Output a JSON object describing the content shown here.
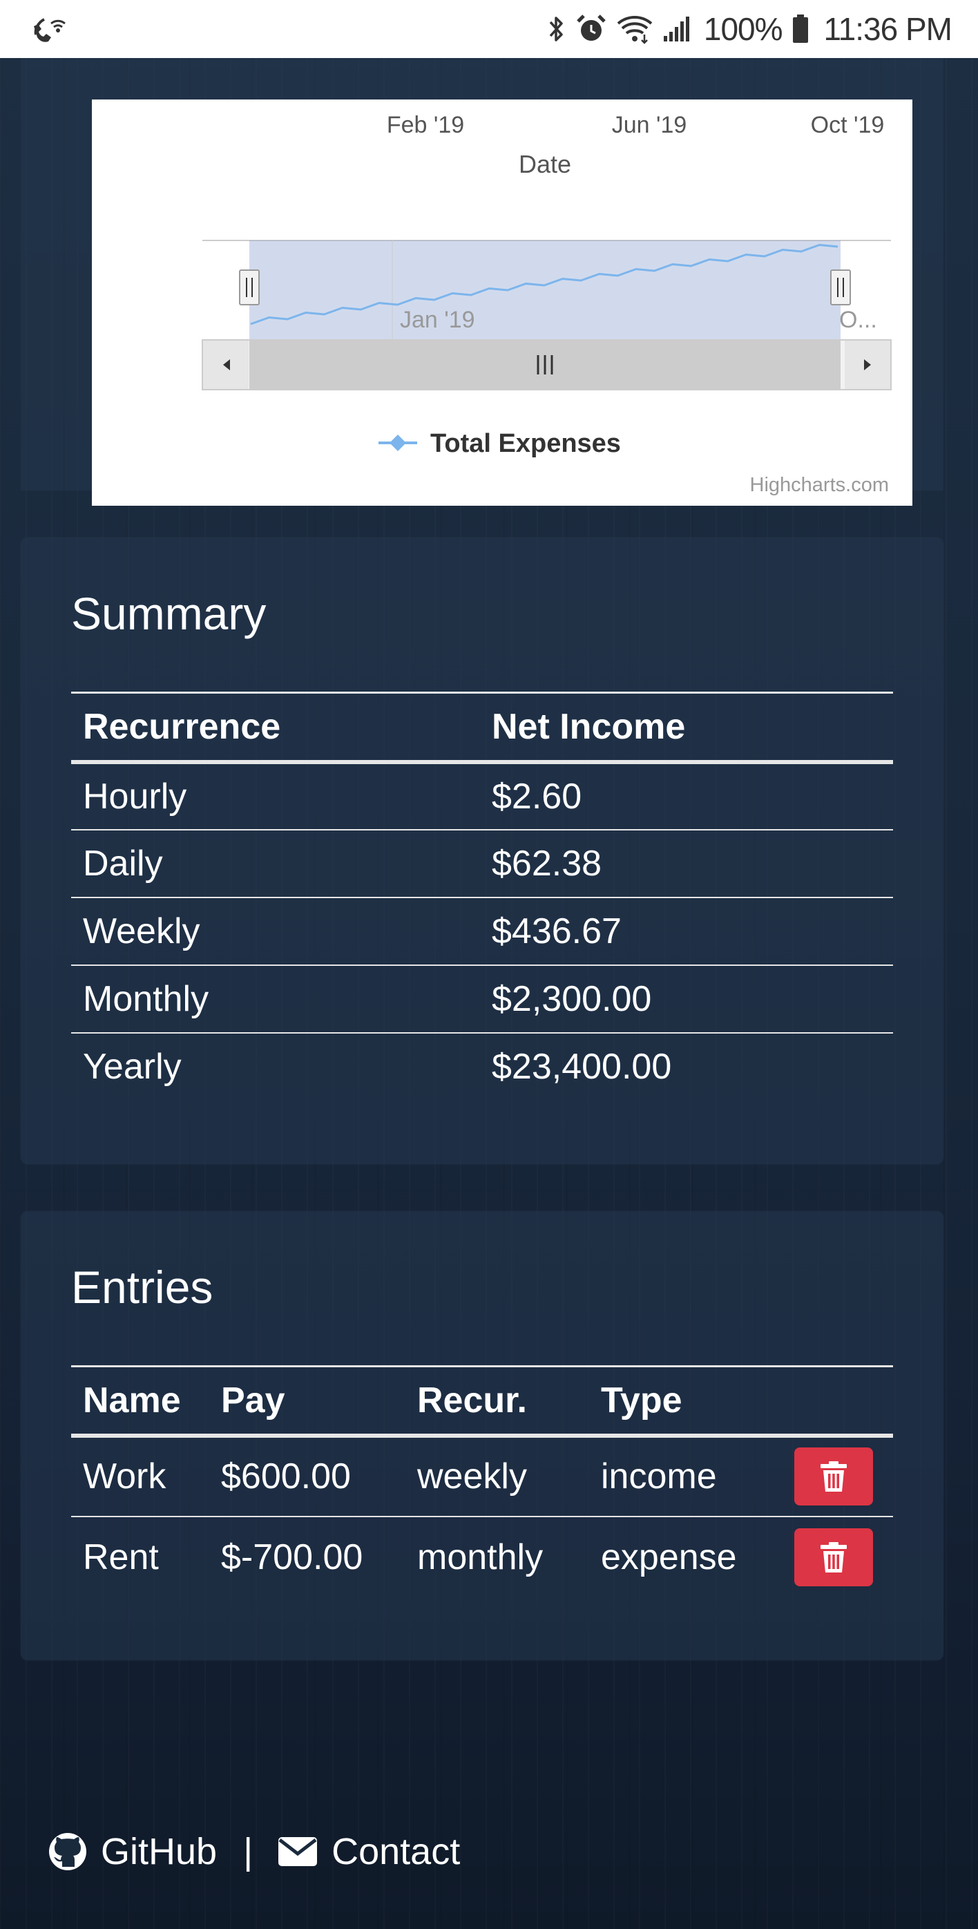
{
  "status_bar": {
    "battery": "100%",
    "time": "11:36 PM",
    "icons": [
      "wifi-calling-icon",
      "bluetooth-icon",
      "alarm-icon",
      "wifi-icon",
      "signal-icon",
      "battery-icon"
    ]
  },
  "chart_data": {
    "type": "line",
    "title": "",
    "xlabel": "Date",
    "ylabel": "",
    "x_ticks": [
      "Feb '19",
      "Jun '19",
      "Oct '19"
    ],
    "navigator": {
      "tick_labels": [
        "Jan '19",
        "O..."
      ],
      "series_trend": "increasing"
    },
    "series": [
      {
        "name": "Total Expenses",
        "color": "#7cb5ec"
      }
    ],
    "legend_placement": "bottom-center",
    "credit": "Highcharts.com"
  },
  "summary": {
    "title": "Summary",
    "columns": [
      "Recurrence",
      "Net Income"
    ],
    "rows": [
      {
        "recurrence": "Hourly",
        "net_income": "$2.60"
      },
      {
        "recurrence": "Daily",
        "net_income": "$62.38"
      },
      {
        "recurrence": "Weekly",
        "net_income": "$436.67"
      },
      {
        "recurrence": "Monthly",
        "net_income": "$2,300.00"
      },
      {
        "recurrence": "Yearly",
        "net_income": "$23,400.00"
      }
    ]
  },
  "entries": {
    "title": "Entries",
    "columns": [
      "Name",
      "Pay",
      "Recur.",
      "Type"
    ],
    "rows": [
      {
        "name": "Work",
        "pay": "$600.00",
        "recur": "weekly",
        "type": "income"
      },
      {
        "name": "Rent",
        "pay": "$-700.00",
        "recur": "monthly",
        "type": "expense"
      }
    ],
    "delete_color": "#dc3545"
  },
  "footer": {
    "github_label": "GitHub",
    "separator": "|",
    "contact_label": "Contact"
  }
}
